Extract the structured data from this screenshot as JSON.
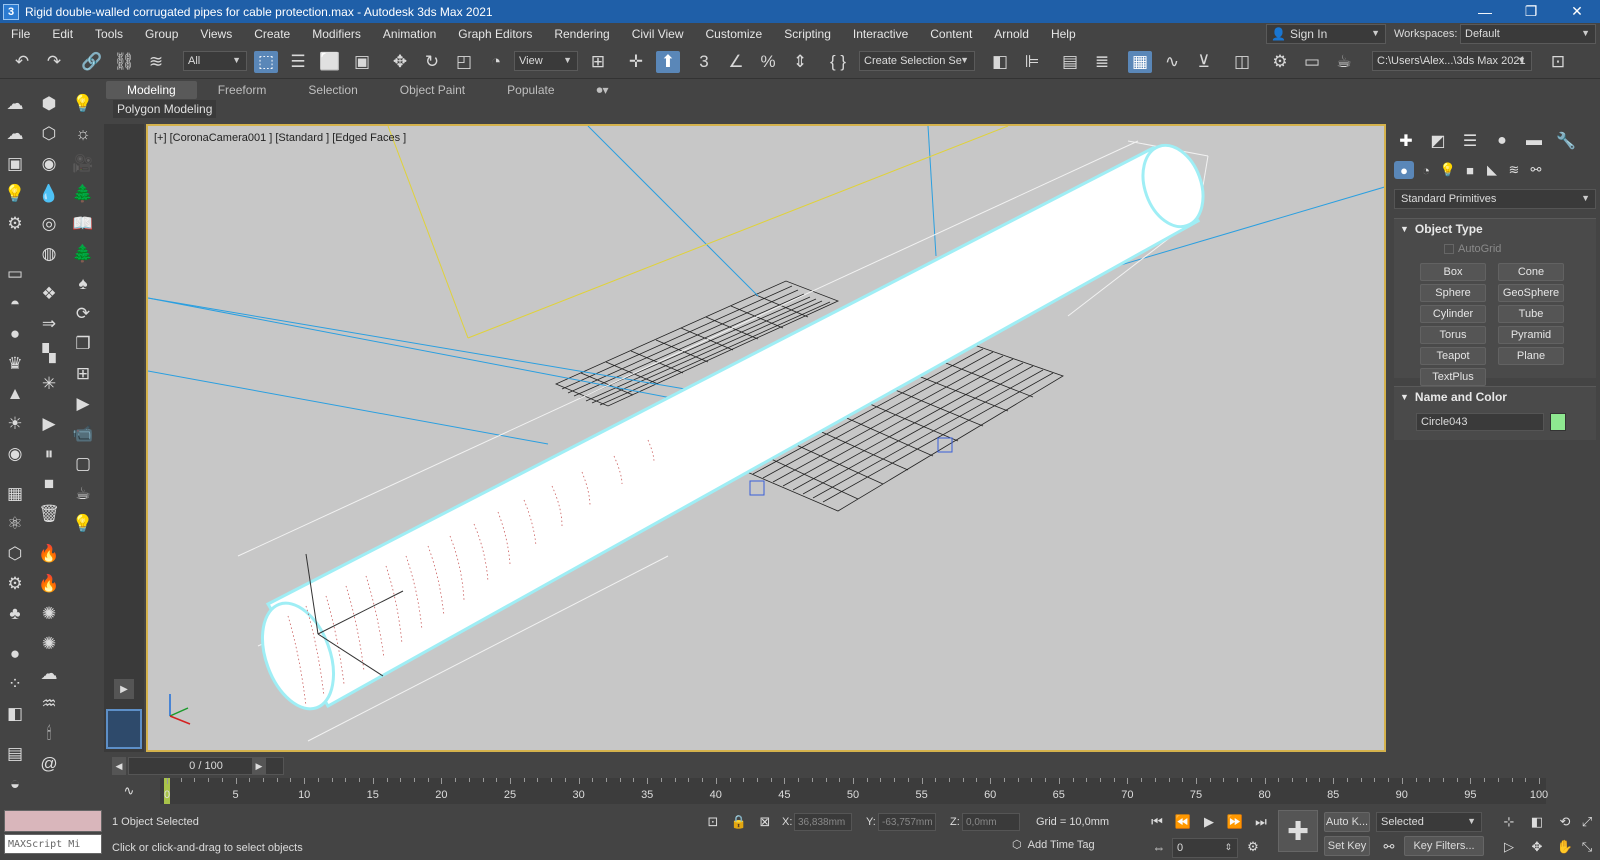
{
  "window": {
    "title": "Rigid double-walled corrugated pipes for cable protection.max - Autodesk 3ds Max 2021",
    "app_icon": "3",
    "controls": [
      "—",
      "❐",
      "✕"
    ]
  },
  "menu": [
    "File",
    "Edit",
    "Tools",
    "Group",
    "Views",
    "Create",
    "Modifiers",
    "Animation",
    "Graph Editors",
    "Rendering",
    "Civil View",
    "Customize",
    "Scripting",
    "Interactive",
    "Content",
    "Arnold",
    "Help"
  ],
  "account": {
    "sign_in": "Sign In",
    "workspaces_label": "Workspaces:",
    "workspace": "Default"
  },
  "toolbar": {
    "selection_filter": "All",
    "ref_coord": "View",
    "named_selection": "Create Selection Se",
    "project_path": "C:\\Users\\Alex...\\3ds Max 2021"
  },
  "ribbon": {
    "tabs": [
      "Modeling",
      "Freeform",
      "Selection",
      "Object Paint",
      "Populate"
    ],
    "panel": "Polygon Modeling"
  },
  "viewport": {
    "label": "[+] [CoronaCamera001 ] [Standard ] [Edged Faces ]"
  },
  "command_panel": {
    "category": "Standard Primitives",
    "object_type": {
      "title": "Object Type",
      "autogrid": "AutoGrid",
      "buttons": [
        "Box",
        "Cone",
        "Sphere",
        "GeoSphere",
        "Cylinder",
        "Tube",
        "Torus",
        "Pyramid",
        "Teapot",
        "Plane",
        "TextPlus"
      ]
    },
    "name_and_color": {
      "title": "Name and Color",
      "name": "Circle043",
      "color": "#8ee890"
    }
  },
  "timeline": {
    "slider_text": "0 / 100",
    "ticks": [
      "0",
      "5",
      "10",
      "15",
      "20",
      "25",
      "30",
      "35",
      "40",
      "45",
      "50",
      "55",
      "60",
      "65",
      "70",
      "75",
      "80",
      "85",
      "90",
      "95",
      "100"
    ]
  },
  "status": {
    "selected": "1 Object Selected",
    "prompt": "Click or click-and-drag to select objects",
    "maxscript": "MAXScript Mi",
    "x_label": "X:",
    "x_val": "36,838mm",
    "y_label": "Y:",
    "y_val": "-63,757mm",
    "z_label": "Z:",
    "z_val": "0,0mm",
    "grid": "Grid = 10,0mm",
    "add_time_tag": "Add Time Tag",
    "auto_key": "Auto K...",
    "set_key": "Set Key",
    "key_mode": "Selected",
    "frame": "0",
    "key_filters": "Key Filters..."
  },
  "colors": {
    "titlebar": "#1f5fa8",
    "viewport_bg": "#c7c7c7",
    "active_border": "#d4b24c",
    "selection_blue": "#5a87b8"
  }
}
